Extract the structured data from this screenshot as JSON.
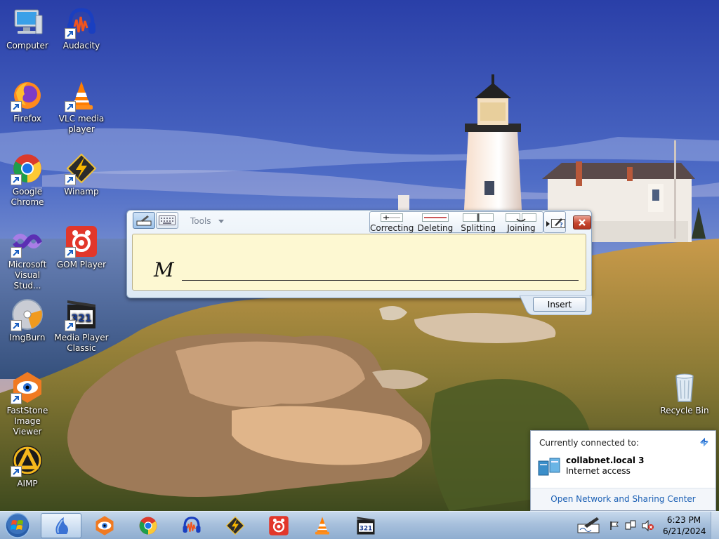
{
  "desktop": {
    "icons": [
      {
        "label": "Computer",
        "icon": "computer-icon"
      },
      {
        "label": "Audacity",
        "icon": "audacity-icon"
      },
      {
        "label": "Firefox",
        "icon": "firefox-icon"
      },
      {
        "label": "VLC media player",
        "icon": "vlc-icon"
      },
      {
        "label": "Google Chrome",
        "icon": "chrome-icon"
      },
      {
        "label": "Winamp",
        "icon": "winamp-icon"
      },
      {
        "label": "Microsoft Visual Stud...",
        "icon": "visual-studio-icon"
      },
      {
        "label": "GOM Player",
        "icon": "gom-player-icon"
      },
      {
        "label": "ImgBurn",
        "icon": "imgburn-icon"
      },
      {
        "label": "Media Player Classic",
        "icon": "media-player-classic-icon"
      },
      {
        "label": "FastStone Image Viewer",
        "icon": "faststone-icon"
      },
      {
        "label": "AIMP",
        "icon": "aimp-icon"
      },
      {
        "label": "Recycle Bin",
        "icon": "recycle-bin-icon"
      }
    ]
  },
  "input_panel": {
    "tools_label": "Tools",
    "gestures": [
      "Correcting",
      "Deleting",
      "Splitting",
      "Joining"
    ],
    "ink_text": "M",
    "insert_label": "Insert"
  },
  "network_popup": {
    "heading": "Currently connected to:",
    "network_name": "collabnet.local  3",
    "status": "Internet access",
    "footer_link": "Open Network and Sharing Center"
  },
  "taskbar": {
    "pinned": [
      "tablet-pc-icon",
      "faststone-icon",
      "chrome-icon",
      "audacity-icon",
      "winamp-icon",
      "gom-player-icon",
      "vlc-icon",
      "media-player-classic-icon"
    ],
    "clock_time": "6:23 PM",
    "clock_date": "6/21/2024"
  },
  "colors": {
    "sky": "#3a4fa8",
    "pad": "#fdf8d2",
    "link": "#1a5fb4",
    "close_red": "#c7462f"
  }
}
